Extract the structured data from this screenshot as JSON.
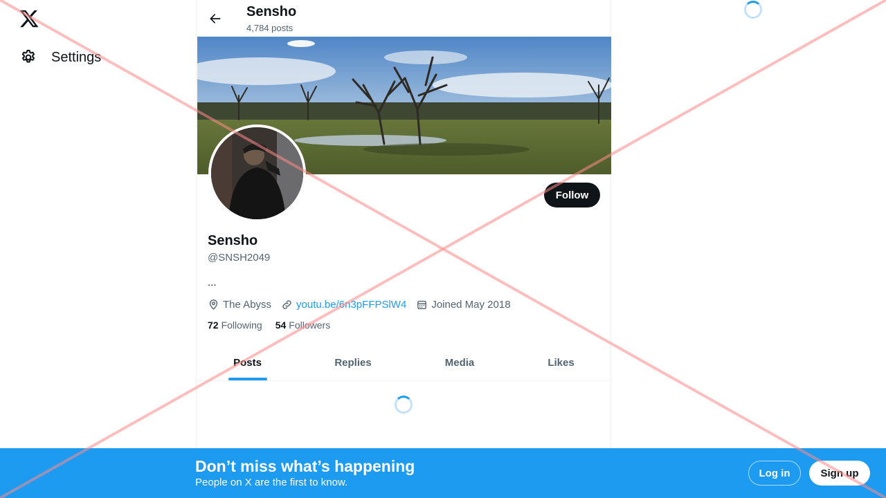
{
  "nav": {
    "settings_label": "Settings"
  },
  "header": {
    "title": "Sensho",
    "post_count": "4,784 posts"
  },
  "profile": {
    "name": "Sensho",
    "handle": "@SNSH2049",
    "bio": "...",
    "location": "The Abyss",
    "link": "youtu.be/6n3pFFPSlW4",
    "joined": "Joined May 2018",
    "following_count": "72",
    "following_label": "Following",
    "followers_count": "54",
    "followers_label": "Followers",
    "follow_label": "Follow"
  },
  "tabs": [
    {
      "label": "Posts",
      "active": true
    },
    {
      "label": "Replies",
      "active": false
    },
    {
      "label": "Media",
      "active": false
    },
    {
      "label": "Likes",
      "active": false
    }
  ],
  "bottom_banner": {
    "title": "Don’t miss what’s happening",
    "subtitle": "People on X are the first to know.",
    "login_label": "Log in",
    "signup_label": "Sign up"
  },
  "colors": {
    "accent": "#1d9bf0",
    "text": "#0f1419",
    "secondary": "#536471",
    "overlay_x": "#ff8a8a"
  }
}
